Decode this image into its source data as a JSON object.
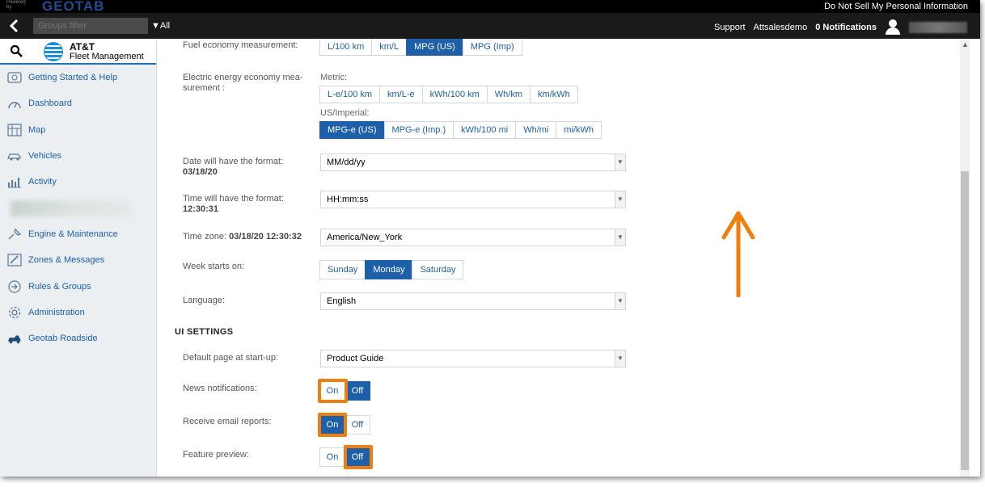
{
  "topbar": {
    "powered_by": "Powered by",
    "logo": "GEOTAB",
    "privacy_link": "Do Not Sell My Personal Information"
  },
  "navbar": {
    "groups_filter_placeholder": "Groups filter",
    "all_label": "All",
    "support": "Support",
    "account": "Attsalesdemo",
    "notifications": "0 Notifications"
  },
  "brand": {
    "title": "AT&T",
    "subtitle": "Fleet Management"
  },
  "sidebar": {
    "items": [
      {
        "label": "Getting Started & Help",
        "icon": "help-icon"
      },
      {
        "label": "Dashboard",
        "icon": "dashboard-icon"
      },
      {
        "label": "Map",
        "icon": "map-icon"
      },
      {
        "label": "Vehicles",
        "icon": "vehicle-icon"
      },
      {
        "label": "Activity",
        "icon": "activity-icon"
      },
      {
        "label": "Engine & Maintenance",
        "icon": "engine-icon"
      },
      {
        "label": "Zones & Messages",
        "icon": "zones-icon"
      },
      {
        "label": "Rules & Groups",
        "icon": "rules-icon"
      },
      {
        "label": "Administration",
        "icon": "gear-icon"
      },
      {
        "label": "Geotab Roadside",
        "icon": "roadside-icon"
      }
    ]
  },
  "settings": {
    "fuel_label": "Fuel economy measurement:",
    "fuel_options": [
      "L/100 km",
      "km/L",
      "MPG (US)",
      "MPG (Imp)"
    ],
    "fuel_selected": 2,
    "electric_label_1": "Electric energy economy mea-",
    "electric_label_2": "surement :",
    "metric_label": "Metric:",
    "metric_options": [
      "L-e/100 km",
      "km/L-e",
      "kWh/100 km",
      "Wh/km",
      "km/kWh"
    ],
    "imperial_label": "US/Imperial:",
    "imperial_options": [
      "MPG-e (US)",
      "MPG-e (Imp.)",
      "kWh/100 mi",
      "Wh/mi",
      "mi/kWh"
    ],
    "imperial_selected": 0,
    "date_label": "Date will have the format:",
    "date_example": "03/18/20",
    "date_value": "MM/dd/yy",
    "time_label": "Time will have the format:",
    "time_example": "12:30:31",
    "time_value": "HH:mm:ss",
    "tz_label": "Time zone:",
    "tz_example": "03/18/20 12:30:32",
    "tz_value": "America/New_York",
    "week_label": "Week starts on:",
    "week_options": [
      "Sunday",
      "Monday",
      "Saturday"
    ],
    "week_selected": 1,
    "language_label": "Language:",
    "language_value": "English",
    "ui_section": "UI SETTINGS",
    "default_page_label": "Default page at start-up:",
    "default_page_value": "Product Guide",
    "news_label": "News notifications:",
    "email_label": "Receive email reports:",
    "preview_label": "Feature preview:",
    "on": "On",
    "off": "Off",
    "news_selected": "off",
    "email_selected": "on",
    "preview_selected": "off"
  },
  "colors": {
    "accent": "#1d5fa8",
    "highlight": "#f07d0c"
  }
}
